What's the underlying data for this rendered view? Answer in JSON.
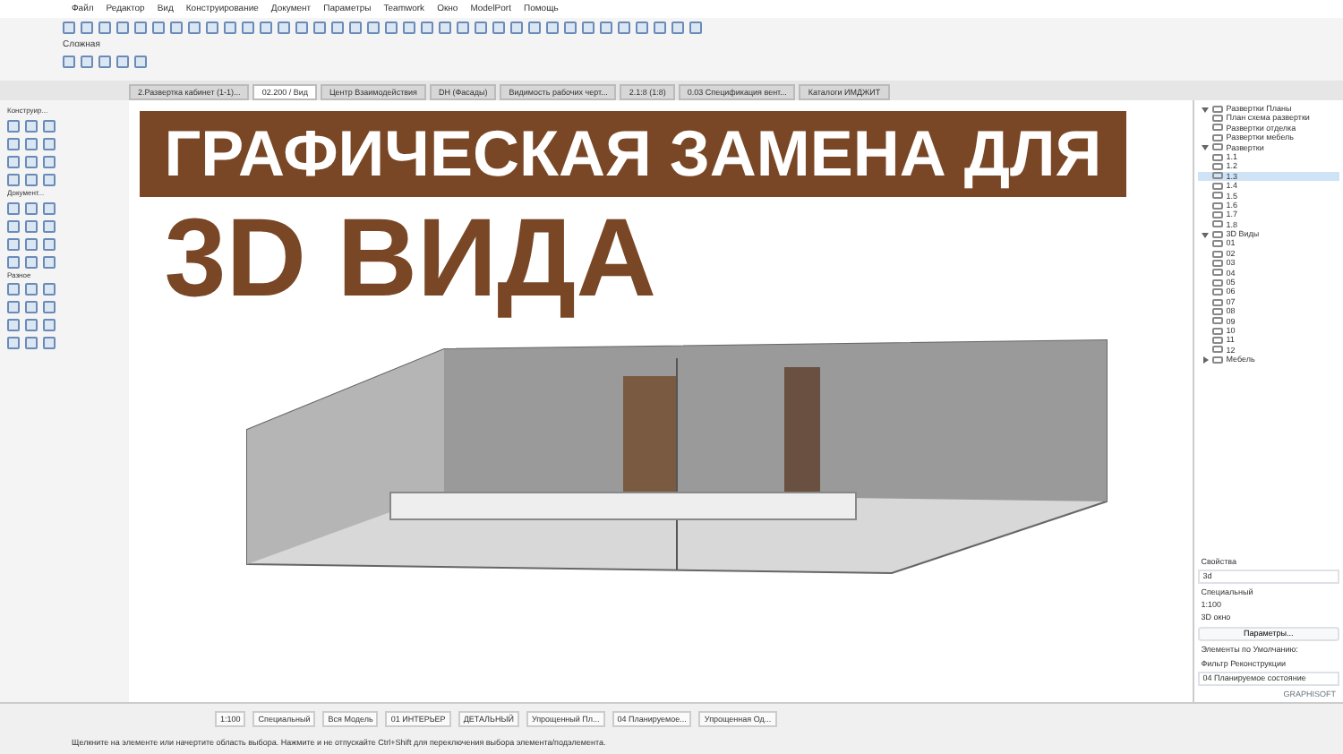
{
  "menu": [
    "Файл",
    "Редактор",
    "Вид",
    "Конструирование",
    "Документ",
    "Параметры",
    "Teamwork",
    "Окно",
    "ModelPort",
    "Помощь"
  ],
  "toolbar": {
    "label": "Сложная"
  },
  "tabs": [
    {
      "label": "2.Развертка кабинет (1-1)...",
      "selected": false
    },
    {
      "label": "02.200 / Вид",
      "selected": true
    },
    {
      "label": "Центр Взаимодействия",
      "selected": false
    },
    {
      "label": "DH (Фасады)",
      "selected": false
    },
    {
      "label": "Видимость рабочих черт...",
      "selected": false
    },
    {
      "label": "2.1:8 (1:8)",
      "selected": false
    },
    {
      "label": "0.03 Спецификация вент...",
      "selected": false
    },
    {
      "label": "Каталоги ИМДЖИТ",
      "selected": false
    }
  ],
  "toolbox": {
    "sections": [
      "Конструир...",
      "Документ...",
      "Разное"
    ]
  },
  "banner": {
    "line_1": "ГРАФИЧЕСКАЯ ЗАМЕНА ДЛЯ",
    "line_2": "3D ВИДА"
  },
  "navigator": {
    "items": [
      {
        "label": "Развертки Планы",
        "expanded": true,
        "selected": false,
        "children": [
          {
            "label": "План схема развертки",
            "selected": false
          },
          {
            "label": "Развертки отделка",
            "selected": false
          },
          {
            "label": "Развертки мебель",
            "selected": false
          }
        ]
      },
      {
        "label": "Развертки",
        "expanded": true,
        "selected": false,
        "children": [
          {
            "label": "1.1",
            "selected": false
          },
          {
            "label": "1.2",
            "selected": false
          },
          {
            "label": "1.3",
            "selected": true
          },
          {
            "label": "1.4",
            "selected": false
          },
          {
            "label": "1.5",
            "selected": false
          },
          {
            "label": "1.6",
            "selected": false
          },
          {
            "label": "1.7",
            "selected": false
          },
          {
            "label": "1.8",
            "selected": false
          }
        ]
      },
      {
        "label": "3D Виды",
        "expanded": true,
        "selected": false,
        "children": [
          {
            "label": "01",
            "selected": false
          },
          {
            "label": "02",
            "selected": false
          },
          {
            "label": "03",
            "selected": false
          },
          {
            "label": "04",
            "selected": false
          },
          {
            "label": "05",
            "selected": false
          },
          {
            "label": "06",
            "selected": false
          },
          {
            "label": "07",
            "selected": false
          },
          {
            "label": "08",
            "selected": false
          },
          {
            "label": "09",
            "selected": false
          },
          {
            "label": "10",
            "selected": false
          },
          {
            "label": "11",
            "selected": false
          },
          {
            "label": "12",
            "selected": false
          }
        ]
      },
      {
        "label": "Мебель",
        "expanded": false,
        "selected": false
      }
    ]
  },
  "properties": {
    "title": "Свойства",
    "id_value": "3d",
    "rows": [
      "Специальный",
      "1:100",
      "3D окно"
    ],
    "button": "Параметры...",
    "defaults_label": "Элементы по Умолчанию:",
    "filter_label": "Фильтр Реконструкции",
    "filter_value": "04 Планируемое состояние",
    "brand": "GRAPHISOFT"
  },
  "bottom_bar": [
    "1:100",
    "Специальный",
    "Вся Модель",
    "01 ИНТЕРЬЕР",
    "ДЕТАЛЬНЫЙ",
    "Упрощенный Пл...",
    "04 Планируемое...",
    "Упрощенная Од..."
  ],
  "status_bar": "Щелкните на элементе или начертите область выбора. Нажмите и не отпускайте Ctrl+Shift для переключения выбора элемента/подэлемента."
}
